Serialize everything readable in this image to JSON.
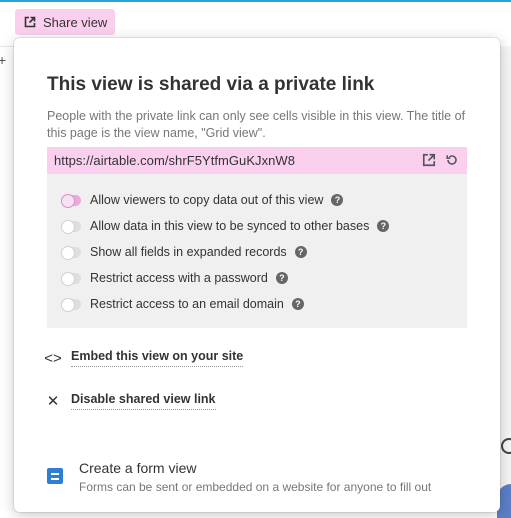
{
  "toolbar": {
    "share_view_label": "Share view"
  },
  "popup": {
    "title": "This view is shared via a private link",
    "description": "People with the private link can only see cells visible in this view. The title of this page is the view name, \"Grid view\".",
    "link_url": "https://airtable.com/shrF5YtfmGuKJxnW8",
    "options": [
      {
        "label": "Allow viewers to copy data out of this view",
        "on": true
      },
      {
        "label": "Allow data in this view to be synced to other bases",
        "on": false
      },
      {
        "label": "Show all fields in expanded records",
        "on": false
      },
      {
        "label": "Restrict access with a password",
        "on": false
      },
      {
        "label": "Restrict access to an email domain",
        "on": false
      }
    ],
    "embed_label": "Embed this view on your site",
    "disable_label": "Disable shared view link",
    "form_title": "Create a form view",
    "form_subtitle": "Forms can be sent or embedded on a website for anyone to fill out"
  },
  "icons": {
    "share": "share-icon",
    "open_link": "open-external-icon",
    "regenerate": "refresh-icon",
    "embed": "code-icon",
    "disable": "close-icon",
    "help": "question-mark-icon",
    "form": "form-icon"
  },
  "colors": {
    "accent_pink": "#fbd0ef",
    "form_blue": "#2d7fd6"
  }
}
